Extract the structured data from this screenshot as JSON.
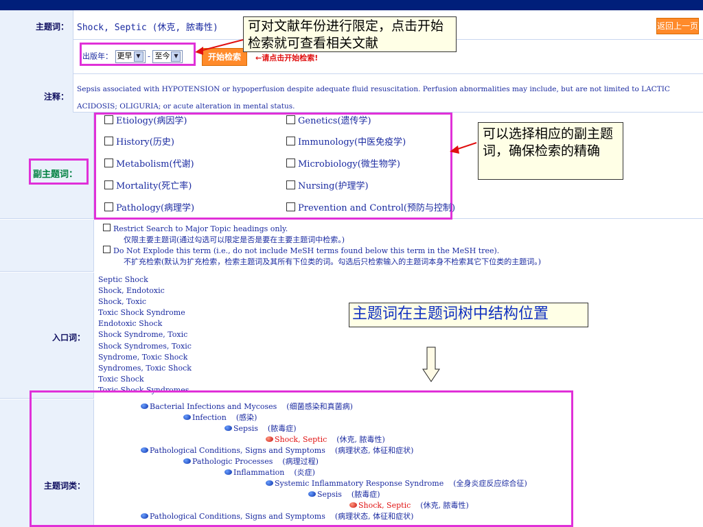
{
  "header": {
    "back_label": "返回上一页"
  },
  "subject": {
    "label": "主题词：",
    "term": "Shock, Septic (休克, 脓毒性)"
  },
  "year_filter": {
    "label": "出版年：",
    "from_value": "更早",
    "separator": "-",
    "to_value": "至今",
    "start_label": "开始检索",
    "hint": "←请点击开始检索!"
  },
  "note": {
    "label": "注释：",
    "text": "Sepsis associated with HYPOTENSION or hypoperfusion despite adequate fluid resuscitation. Perfusion abnormalities may include, but are not limited to LACTIC ACIDOSIS; OLIGURIA; or acute alteration in mental status."
  },
  "subheadings": {
    "label": "副主题词：",
    "items": [
      "Etiology(病因学)",
      "Genetics(遗传学)",
      "History(历史)",
      "Immunology(中医免疫学)",
      "Metabolism(代谢)",
      "Microbiology(微生物学)",
      "Mortality(死亡率)",
      "Nursing(护理学)",
      "Pathology(病理学)",
      "Prevention and Control(预防与控制)"
    ]
  },
  "options": {
    "major_label": "Restrict Search to Major Topic headings only.",
    "major_desc": "仅限主要主题词(通过勾选可以限定是否是要在主要主题词中检索。)",
    "explode_label": "Do Not Explode this term (i.e., do not include MeSH terms found below this term in the MeSH tree).",
    "explode_desc": "不扩充检索(默认为扩充检索，检索主题词及其所有下位类的词。勾选后只检索输入的主题词本身不检索其它下位类的主题词。)"
  },
  "entry_terms": {
    "label": "入口词：",
    "items": [
      "Septic Shock",
      "Shock, Endotoxic",
      "Shock, Toxic",
      "Toxic Shock Syndrome",
      "Endotoxic Shock",
      "Shock Syndrome, Toxic",
      "Shock Syndromes, Toxic",
      "Syndrome, Toxic Shock",
      "Syndromes, Toxic Shock",
      "Toxic Shock",
      "Toxic Shock Syndromes"
    ]
  },
  "tree": {
    "label": "主题词类：",
    "items": [
      {
        "en": "Bacterial Infections and Mycoses",
        "cn": "(细菌感染和真菌病)",
        "level": 0,
        "selected": false
      },
      {
        "en": "Infection",
        "cn": "(感染)",
        "level": 1,
        "selected": false
      },
      {
        "en": "Sepsis",
        "cn": "(脓毒症)",
        "level": 2,
        "selected": false
      },
      {
        "en": "Shock, Septic",
        "cn": "(休克, 脓毒性)",
        "level": 3,
        "selected": true
      },
      {
        "en": "Pathological Conditions, Signs and Symptoms",
        "cn": "(病理状态, 体征和症状)",
        "level": 0,
        "selected": false
      },
      {
        "en": "Pathologic Processes",
        "cn": "(病理过程)",
        "level": 1,
        "selected": false
      },
      {
        "en": "Inflammation",
        "cn": "(炎症)",
        "level": 2,
        "selected": false
      },
      {
        "en": "Systemic Inflammatory Response Syndrome",
        "cn": "(全身炎症反应综合征)",
        "level": 3,
        "selected": false
      },
      {
        "en": "Sepsis",
        "cn": "(脓毒症)",
        "level": 4,
        "selected": false
      },
      {
        "en": "Shock, Septic",
        "cn": "(休克, 脓毒性)",
        "level": 5,
        "selected": true
      },
      {
        "en": "Pathological Conditions, Signs and Symptoms",
        "cn": "(病理状态, 体征和症状)",
        "level": 0,
        "selected": false
      }
    ]
  },
  "annotations": {
    "year_note": "可对文献年份进行限定，点击开始检索就可查看相关文献",
    "subheading_note": "可以选择相应的副主题词，确保检索的精确",
    "tree_note": "主题词在主题词树中结构位置"
  },
  "colors": {
    "header_bar": "#001f7a",
    "accent_button": "#ff8a2a",
    "highlight_frame": "#e030d8",
    "selected_term": "#e01010"
  }
}
